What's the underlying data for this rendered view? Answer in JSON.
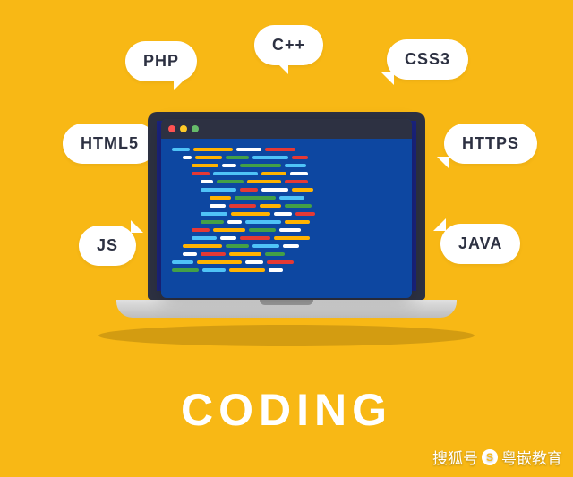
{
  "bubbles": {
    "html5": "HTML5",
    "php": "PHP",
    "cpp": "C++",
    "css3": "CSS3",
    "https": "HTTPS",
    "js": "JS",
    "java": "JAVA"
  },
  "title": "CODING",
  "watermark": {
    "prefix": "搜狐号",
    "author": "粤嵌教育"
  }
}
